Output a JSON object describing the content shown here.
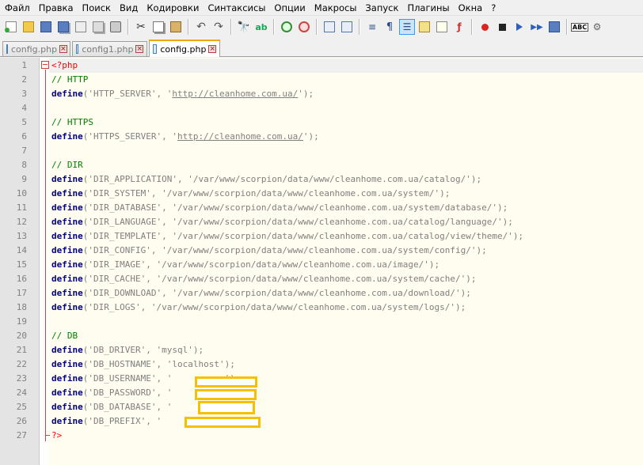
{
  "menu": [
    "Файл",
    "Правка",
    "Поиск",
    "Вид",
    "Кодировки",
    "Синтаксисы",
    "Опции",
    "Макросы",
    "Запуск",
    "Плагины",
    "Окна",
    "?"
  ],
  "toolbar": {
    "icons": [
      "new-file-icon",
      "open-file-icon",
      "save-icon",
      "save-all-icon",
      "close-icon",
      "close-all-icon",
      "print-icon",
      "|",
      "cut-icon",
      "copy-icon",
      "paste-icon",
      "|",
      "undo-icon",
      "redo-icon",
      "|",
      "find-icon",
      "replace-icon",
      "|",
      "zoom-in-icon",
      "zoom-out-icon",
      "|",
      "sync-vertical-icon",
      "sync-horizontal-icon",
      "|",
      "word-wrap-icon",
      "all-chars-icon",
      "indent-guide-icon",
      "user-lang-icon",
      "doc-map-icon",
      "function-list-icon",
      "|",
      "record-macro-icon",
      "stop-record-icon",
      "play-macro-icon",
      "play-multiple-icon",
      "save-macro-icon",
      "|",
      "spellcheck-icon",
      "settings-icon"
    ],
    "active": [
      "indent-guide-icon"
    ]
  },
  "tabs": [
    {
      "label": "config.php",
      "active": false
    },
    {
      "label": "config1.php",
      "active": false
    },
    {
      "label": "config.php",
      "active": true
    }
  ],
  "colors": {
    "keyword": "#000080",
    "comment": "#008000",
    "string": "#808080",
    "tag": "#ff0000",
    "fold": "#d04040",
    "redaction": "#f5c000"
  },
  "code_lines": [
    {
      "n": "1",
      "t": [
        [
          "tag",
          "<?php"
        ]
      ]
    },
    {
      "n": "2",
      "t": [
        [
          "cm",
          "// HTTP"
        ]
      ]
    },
    {
      "n": "3",
      "t": [
        [
          "kw",
          "define"
        ],
        [
          "op",
          "("
        ],
        [
          "str",
          "'HTTP_SERVER'"
        ],
        [
          "op",
          ", "
        ],
        [
          "str",
          "'"
        ],
        [
          "url",
          "http://cleanhome.com.ua/"
        ],
        [
          "str",
          "'"
        ],
        [
          "op",
          ");"
        ]
      ]
    },
    {
      "n": "4",
      "t": []
    },
    {
      "n": "5",
      "t": [
        [
          "cm",
          "// HTTPS"
        ]
      ]
    },
    {
      "n": "6",
      "t": [
        [
          "kw",
          "define"
        ],
        [
          "op",
          "("
        ],
        [
          "str",
          "'HTTPS_SERVER'"
        ],
        [
          "op",
          ", "
        ],
        [
          "str",
          "'"
        ],
        [
          "url",
          "http://cleanhome.com.ua/"
        ],
        [
          "str",
          "'"
        ],
        [
          "op",
          ");"
        ]
      ]
    },
    {
      "n": "7",
      "t": []
    },
    {
      "n": "8",
      "t": [
        [
          "cm",
          "// DIR"
        ]
      ]
    },
    {
      "n": "9",
      "t": [
        [
          "kw",
          "define"
        ],
        [
          "op",
          "("
        ],
        [
          "str",
          "'DIR_APPLICATION'"
        ],
        [
          "op",
          ", "
        ],
        [
          "str",
          "'/var/www/scorpion/data/www/cleanhome.com.ua/catalog/'"
        ],
        [
          "op",
          ");"
        ]
      ]
    },
    {
      "n": "10",
      "t": [
        [
          "kw",
          "define"
        ],
        [
          "op",
          "("
        ],
        [
          "str",
          "'DIR_SYSTEM'"
        ],
        [
          "op",
          ", "
        ],
        [
          "str",
          "'/var/www/scorpion/data/www/cleanhome.com.ua/system/'"
        ],
        [
          "op",
          ");"
        ]
      ]
    },
    {
      "n": "11",
      "t": [
        [
          "kw",
          "define"
        ],
        [
          "op",
          "("
        ],
        [
          "str",
          "'DIR_DATABASE'"
        ],
        [
          "op",
          ", "
        ],
        [
          "str",
          "'/var/www/scorpion/data/www/cleanhome.com.ua/system/database/'"
        ],
        [
          "op",
          ");"
        ]
      ]
    },
    {
      "n": "12",
      "t": [
        [
          "kw",
          "define"
        ],
        [
          "op",
          "("
        ],
        [
          "str",
          "'DIR_LANGUAGE'"
        ],
        [
          "op",
          ", "
        ],
        [
          "str",
          "'/var/www/scorpion/data/www/cleanhome.com.ua/catalog/language/'"
        ],
        [
          "op",
          ");"
        ]
      ]
    },
    {
      "n": "13",
      "t": [
        [
          "kw",
          "define"
        ],
        [
          "op",
          "("
        ],
        [
          "str",
          "'DIR_TEMPLATE'"
        ],
        [
          "op",
          ", "
        ],
        [
          "str",
          "'/var/www/scorpion/data/www/cleanhome.com.ua/catalog/view/theme/'"
        ],
        [
          "op",
          ");"
        ]
      ]
    },
    {
      "n": "14",
      "t": [
        [
          "kw",
          "define"
        ],
        [
          "op",
          "("
        ],
        [
          "str",
          "'DIR_CONFIG'"
        ],
        [
          "op",
          ", "
        ],
        [
          "str",
          "'/var/www/scorpion/data/www/cleanhome.com.ua/system/config/'"
        ],
        [
          "op",
          ");"
        ]
      ]
    },
    {
      "n": "15",
      "t": [
        [
          "kw",
          "define"
        ],
        [
          "op",
          "("
        ],
        [
          "str",
          "'DIR_IMAGE'"
        ],
        [
          "op",
          ", "
        ],
        [
          "str",
          "'/var/www/scorpion/data/www/cleanhome.com.ua/image/'"
        ],
        [
          "op",
          ");"
        ]
      ]
    },
    {
      "n": "16",
      "t": [
        [
          "kw",
          "define"
        ],
        [
          "op",
          "("
        ],
        [
          "str",
          "'DIR_CACHE'"
        ],
        [
          "op",
          ", "
        ],
        [
          "str",
          "'/var/www/scorpion/data/www/cleanhome.com.ua/system/cache/'"
        ],
        [
          "op",
          ");"
        ]
      ]
    },
    {
      "n": "17",
      "t": [
        [
          "kw",
          "define"
        ],
        [
          "op",
          "("
        ],
        [
          "str",
          "'DIR_DOWNLOAD'"
        ],
        [
          "op",
          ", "
        ],
        [
          "str",
          "'/var/www/scorpion/data/www/cleanhome.com.ua/download/'"
        ],
        [
          "op",
          ");"
        ]
      ]
    },
    {
      "n": "18",
      "t": [
        [
          "kw",
          "define"
        ],
        [
          "op",
          "("
        ],
        [
          "str",
          "'DIR_LOGS'"
        ],
        [
          "op",
          ", "
        ],
        [
          "str",
          "'/var/www/scorpion/data/www/cleanhome.com.ua/system/logs/'"
        ],
        [
          "op",
          ");"
        ]
      ]
    },
    {
      "n": "19",
      "t": []
    },
    {
      "n": "20",
      "t": [
        [
          "cm",
          "// DB"
        ]
      ]
    },
    {
      "n": "21",
      "t": [
        [
          "kw",
          "define"
        ],
        [
          "op",
          "("
        ],
        [
          "str",
          "'DB_DRIVER'"
        ],
        [
          "op",
          ", "
        ],
        [
          "str",
          "'mysql'"
        ],
        [
          "op",
          ");"
        ]
      ]
    },
    {
      "n": "22",
      "t": [
        [
          "kw",
          "define"
        ],
        [
          "op",
          "("
        ],
        [
          "str",
          "'DB_HOSTNAME'"
        ],
        [
          "op",
          ", "
        ],
        [
          "str",
          "'localhost'"
        ],
        [
          "op",
          ");"
        ]
      ]
    },
    {
      "n": "23",
      "t": [
        [
          "kw",
          "define"
        ],
        [
          "op",
          "("
        ],
        [
          "str",
          "'DB_USERNAME'"
        ],
        [
          "op",
          ", "
        ],
        [
          "str",
          "'          '"
        ],
        [
          "op",
          ");"
        ]
      ]
    },
    {
      "n": "24",
      "t": [
        [
          "kw",
          "define"
        ],
        [
          "op",
          "("
        ],
        [
          "str",
          "'DB_PASSWORD'"
        ],
        [
          "op",
          ", "
        ],
        [
          "str",
          "'          '"
        ],
        [
          "op",
          ");"
        ]
      ]
    },
    {
      "n": "25",
      "t": [
        [
          "kw",
          "define"
        ],
        [
          "op",
          "("
        ],
        [
          "str",
          "'DB_DATABASE'"
        ],
        [
          "op",
          ", "
        ],
        [
          "str",
          "'          '"
        ],
        [
          "op",
          ");"
        ]
      ]
    },
    {
      "n": "26",
      "t": [
        [
          "kw",
          "define"
        ],
        [
          "op",
          "("
        ],
        [
          "str",
          "'DB_PREFIX'"
        ],
        [
          "op",
          ", "
        ],
        [
          "str",
          "'            "
        ]
      ]
    },
    {
      "n": "27",
      "t": [
        [
          "tag",
          "?>"
        ]
      ]
    }
  ]
}
